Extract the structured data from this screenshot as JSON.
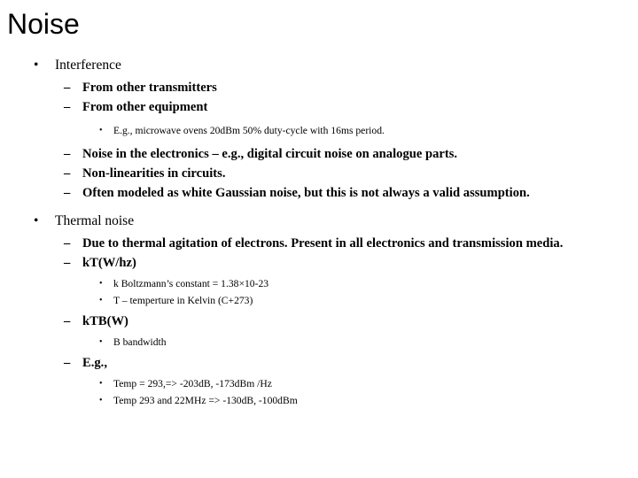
{
  "slide": {
    "title": "Noise",
    "bullet_markers": {
      "level1": "•",
      "level2": "–",
      "level3": "•"
    },
    "content": [
      {
        "level": 1,
        "text": "Interference"
      },
      {
        "level": 2,
        "text": "From other transmitters"
      },
      {
        "level": 2,
        "text": "From other equipment"
      },
      {
        "level": 3,
        "text": "E.g., microwave ovens 20dBm 50% duty-cycle with 16ms period."
      },
      {
        "level": 2,
        "text": "Noise in the electronics – e.g., digital circuit noise on analogue parts."
      },
      {
        "level": 2,
        "text": "Non-linearities in circuits."
      },
      {
        "level": 2,
        "text": "Often modeled as white Gaussian noise, but this is not always a valid assumption."
      },
      {
        "level": 1,
        "text": "Thermal noise"
      },
      {
        "level": 2,
        "text": "Due to thermal agitation of electrons. Present in all electronics and transmission media."
      },
      {
        "level": 2,
        "text": "kT(W/hz)"
      },
      {
        "level": 3,
        "text": "k Boltzmann’s constant = 1.38×10-23"
      },
      {
        "level": 3,
        "text": "T – temperture in Kelvin (C+273)"
      },
      {
        "level": 2,
        "text": "kTB(W)"
      },
      {
        "level": 3,
        "text": "B bandwidth"
      },
      {
        "level": 2,
        "text": "E.g.,"
      },
      {
        "level": 3,
        "text": "Temp = 293,=> -203dB, -173dBm /Hz"
      },
      {
        "level": 3,
        "text": "Temp 293 and 22MHz => -130dB, -100dBm"
      }
    ]
  },
  "colors": {
    "background": "#ffffff",
    "text": "#000000"
  }
}
